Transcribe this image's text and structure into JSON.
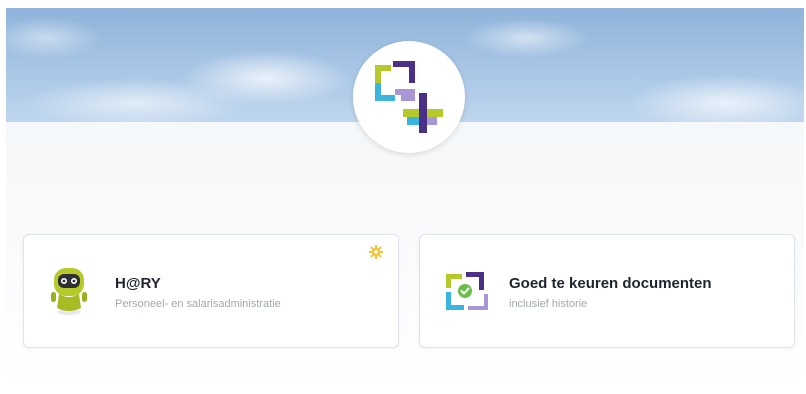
{
  "cards": [
    {
      "title": "H@RY",
      "subtitle": "Personeel- en salarisadministratie",
      "icon": "robot-mascot-icon",
      "corner_icon": "settings-gear-icon"
    },
    {
      "title": "Goed te keuren documenten",
      "subtitle": "inclusief historie",
      "icon": "document-approval-icon"
    }
  ],
  "colors": {
    "lime": "#b5c92a",
    "purple": "#5d3f9a",
    "cyan": "#39b5e0",
    "green_check": "#6abf4b",
    "gear": "#f2c12e"
  }
}
